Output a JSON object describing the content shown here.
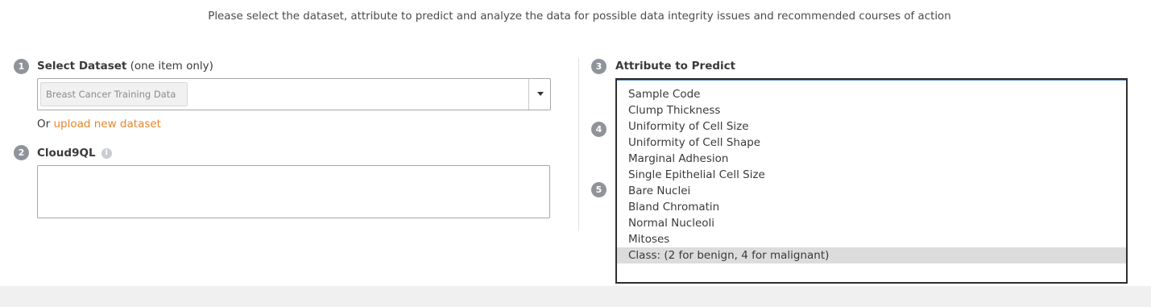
{
  "intro_text": "Please select the dataset, attribute to predict and analyze the data for possible data integrity issues and recommended courses of action",
  "steps": {
    "s1": "1",
    "s2": "2",
    "s3": "3",
    "s4": "4",
    "s5": "5"
  },
  "dataset": {
    "label": "Select Dataset",
    "label_hint": "(one item only)",
    "selected": "Breast Cancer Training Data",
    "upload_prefix": "Or ",
    "upload_link": "upload new dataset"
  },
  "cloud9ql": {
    "label": "Cloud9QL",
    "info_icon": "i",
    "value": ""
  },
  "attribute": {
    "label": "Attribute to Predict",
    "options": [
      "Sample Code",
      "Clump Thickness",
      "Uniformity of Cell Size",
      "Uniformity of Cell Shape",
      "Marginal Adhesion",
      "Single Epithelial Cell Size",
      "Bare Nuclei",
      "Bland Chromatin",
      "Normal Nucleoli",
      "Mitoses",
      "Class: (2 for benign, 4 for malignant)"
    ],
    "selected_index": 10
  },
  "colors": {
    "accent_link": "#e8862a",
    "badge": "#8e9499",
    "selected_row": "#dcdcdc"
  }
}
